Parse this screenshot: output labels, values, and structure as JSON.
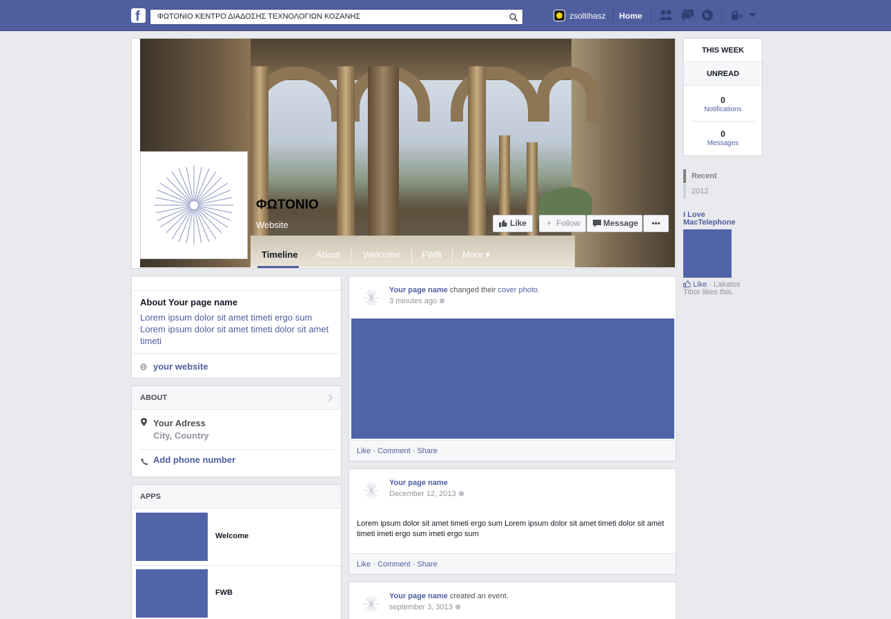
{
  "topbar": {
    "logo": "f",
    "search_value": "ΦΩΤΟΝΙΟ ΚΕΝΤΡΟ ΔΙΑΔΟΣΗΣ ΤΕΧΝΟΛΟΓΙΩΝ ΚΟΖΑΝΗΣ",
    "user_name": "zsoltihasz",
    "home": "Home"
  },
  "cover": {
    "title": "ΦΩΤΟΝΙΟ",
    "category": "Website",
    "tabs": [
      "Timeline",
      "About",
      "Welcome",
      "FWB",
      "More ▾"
    ],
    "actions": {
      "like": "Like",
      "follow": "Follow",
      "message": "Message",
      "more": "•••"
    }
  },
  "ticker": {
    "this_week": "THIS WEEK",
    "unread": "UNREAD",
    "notifications_count": "0",
    "notifications_label": "Notifications",
    "messages_count": "0",
    "messages_label": "Messages"
  },
  "timeline_nav": {
    "recent": "Recent",
    "year": "2012"
  },
  "ad": {
    "title": "I Love MacTelephone",
    "like": "Like",
    "like_text": " · Lakatos Tibor likes this."
  },
  "about_card": {
    "title": "About Your page name",
    "body": "Lorem ipsum dolor sit amet timeti ergo sum Lorem ipsum dolor sit amet timeti dolor sit amet timeti",
    "website": "your website"
  },
  "about_section": {
    "header": "ABOUT",
    "address_line1": "Your Adress",
    "address_line2": "City, Country",
    "phone": "Add phone number"
  },
  "apps": {
    "header": "APPS",
    "items": [
      {
        "name": "Welcome"
      },
      {
        "name": "FWB"
      }
    ]
  },
  "feed": [
    {
      "author": "Your page name",
      "action": " changed their ",
      "link": "cover photo.",
      "time": "3 minutes ago",
      "footer": "Like · Comment · Share"
    },
    {
      "author": "Your page name",
      "time": "December 12, 2013",
      "text": "Lorem ipsum dolor sit amet timeti ergo sum Lorem ipsum dolor sit amet timeti dolor sit amet timeti imeti ergo sum imeti ergo sum",
      "footer": "Like · Comment · Share"
    },
    {
      "author": "Your page name",
      "action": " created an event.",
      "time": "september 3, 3013"
    }
  ],
  "colors": {
    "brand": "#4e5e9f",
    "placeholder_blue": "#5164a8",
    "background": "#e9eaed"
  }
}
